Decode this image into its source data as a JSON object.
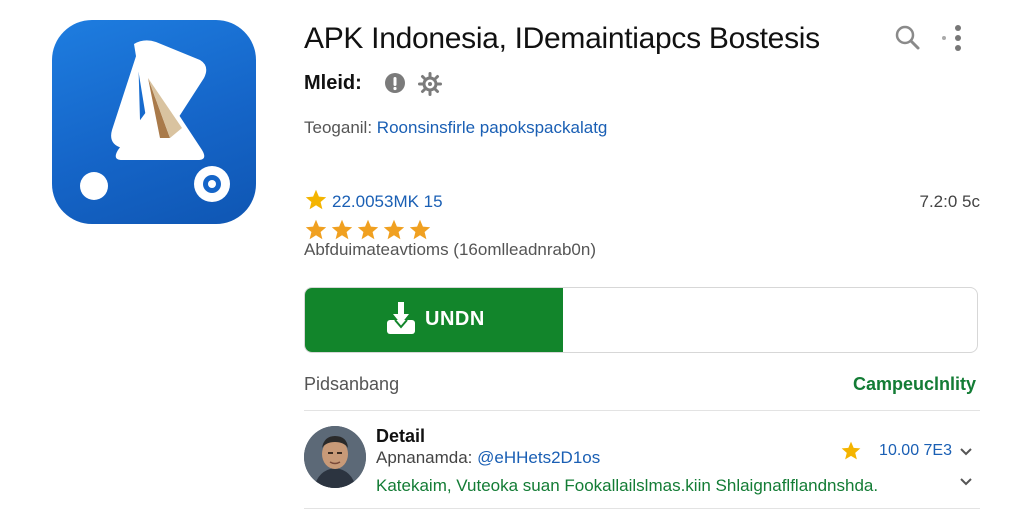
{
  "app": {
    "title": "APK Indonesia, IDemaintiapcs Bostesis",
    "icon": "app-logo-icon"
  },
  "meta": {
    "label": "Mleid:",
    "icons": [
      "info-icon",
      "settings-icon"
    ]
  },
  "tag": {
    "label": "Teoganil:",
    "value": "Roonsinsfirle papokspackalatg"
  },
  "rating": {
    "value": "22.0053MK 15",
    "version": "7.2:0 5c",
    "stars": 5,
    "reviews": "Abfduimateavtioms (16omlleadnrab0n)"
  },
  "install": {
    "label": "UNDN",
    "icon": "download-icon"
  },
  "section": {
    "left": "Pidsanbang",
    "right": "Campeuclnlity"
  },
  "review": {
    "title": "Detail",
    "sub_label": "Apnanamda:",
    "sub_value": "@eHHets2D1os",
    "rating": "10.00 7E3",
    "text": "Katekaim, Vuteoka suan Fookallailslmas.kiin Shlaignaflflandnshda."
  },
  "colors": {
    "accent_green": "#12852b",
    "link_blue": "#1a5fb4",
    "star_gold": "#f4b400",
    "icon_blue": "#1565c8"
  }
}
